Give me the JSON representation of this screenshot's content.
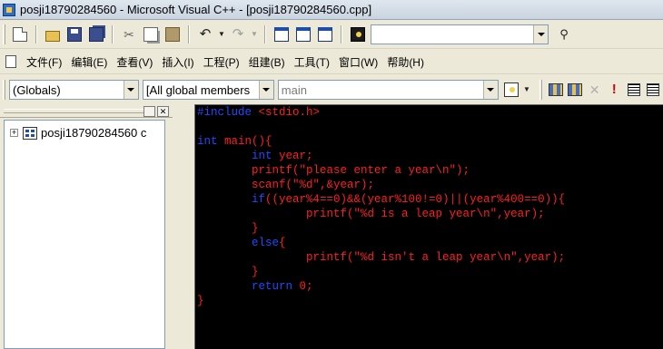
{
  "window": {
    "title": "posji18790284560 - Microsoft Visual C++ - [posji18790284560.cpp]"
  },
  "toolbar": {
    "find_combo_value": ""
  },
  "menu": {
    "items": [
      {
        "label": "文件(F)"
      },
      {
        "label": "编辑(E)"
      },
      {
        "label": "查看(V)"
      },
      {
        "label": "插入(I)"
      },
      {
        "label": "工程(P)"
      },
      {
        "label": "组建(B)"
      },
      {
        "label": "工具(T)"
      },
      {
        "label": "窗口(W)"
      },
      {
        "label": "帮助(H)"
      }
    ]
  },
  "wizard": {
    "class_combo": "(Globals)",
    "filter_combo": "[All global members",
    "members_combo": "main"
  },
  "workspace": {
    "tree_item": "posji18790284560 c"
  },
  "editor": {
    "colors": {
      "keyword": "#1a4cff",
      "text": "#ff1f1f",
      "background": "#000000"
    },
    "lines": [
      {
        "kw": "#include",
        "rest": " <stdio.h>",
        "indent": ""
      },
      {
        "kw": "",
        "rest": "",
        "indent": ""
      },
      {
        "kw": "int",
        "rest": " main(){",
        "indent": ""
      },
      {
        "kw": "int",
        "rest": " year;",
        "indent": "        "
      },
      {
        "kw": "",
        "rest": "printf(\"please enter a year\\n\");",
        "indent": "        "
      },
      {
        "kw": "",
        "rest": "scanf(\"%d\",&year);",
        "indent": "        "
      },
      {
        "kw": "if",
        "rest": "((year%4==0)&&(year%100!=0)||(year%400==0)){",
        "indent": "        "
      },
      {
        "kw": "",
        "rest": "printf(\"%d is a leap year\\n\",year);",
        "indent": "                "
      },
      {
        "kw": "",
        "rest": "}",
        "indent": "        "
      },
      {
        "kw": "else",
        "rest": "{",
        "indent": "        "
      },
      {
        "kw": "",
        "rest": "printf(\"%d isn't a leap year\\n\",year);",
        "indent": "                "
      },
      {
        "kw": "",
        "rest": "}",
        "indent": "        "
      },
      {
        "kw": "return",
        "rest": " 0;",
        "indent": "        "
      },
      {
        "kw": "",
        "rest": "}",
        "indent": ""
      }
    ]
  }
}
